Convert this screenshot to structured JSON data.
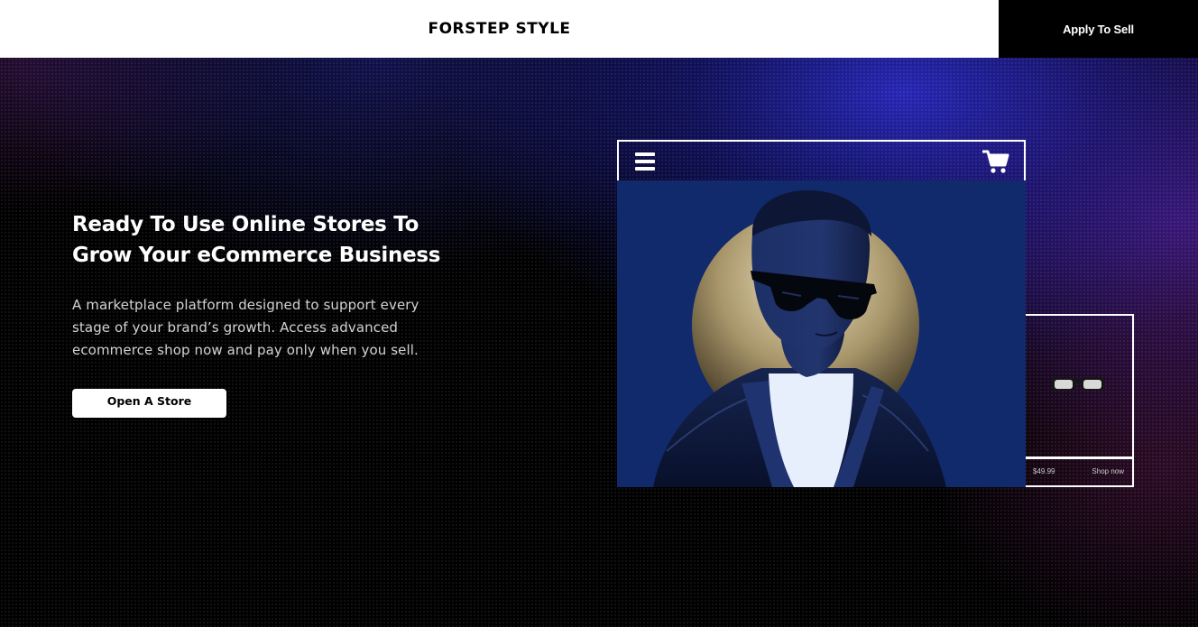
{
  "header": {
    "brand": "FORSTEP STYLE",
    "apply_label": "Apply To Sell"
  },
  "hero": {
    "headline_line1": "Ready To Use Online Stores To",
    "headline_line2": "Grow Your eCommerce Business",
    "description_line1": "A marketplace platform designed to support every",
    "description_line2": "stage of your brand’s growth. Access advanced",
    "description_line3": "ecommerce shop now and pay only when you sell.",
    "cta_label": "Open A Store"
  },
  "mockup": {
    "menu_icon": "hamburger-menu-icon",
    "cart_icon": "shopping-cart-icon"
  },
  "product_card": {
    "price": "$49.99",
    "shop_label": "Shop now"
  },
  "colors": {
    "header_bg": "#ffffff",
    "apply_bg": "#000000",
    "hero_glow": "#2828be",
    "photo_bg": "#112a6b",
    "cta_bg": "#ffffff"
  }
}
